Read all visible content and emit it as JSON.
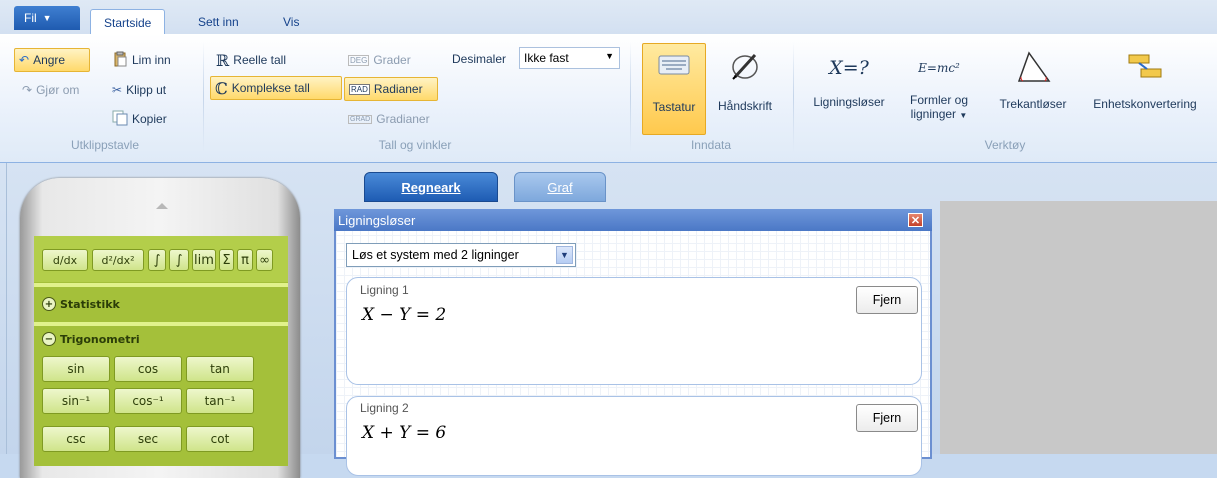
{
  "menu": {
    "file_label": "Fil",
    "file_arrow": "▼"
  },
  "tabs": [
    "Startside",
    "Sett inn",
    "Vis"
  ],
  "ribbon": {
    "clipboard": {
      "undo": "Angre",
      "redo": "Gjør om",
      "paste": "Lim inn",
      "cut": "Klipp ut",
      "copy": "Kopier",
      "group": "Utklippstavle"
    },
    "numbers": {
      "real": "Reelle tall",
      "complex": "Komplekse tall",
      "degrees_badge": "DEG",
      "degrees": "Grader",
      "radians_badge": "RAD",
      "radians": "Radianer",
      "gradians_badge": "GRAD",
      "gradians": "Gradianer",
      "decimals_label": "Desimaler",
      "decimals_value": "Ikke fast",
      "group": "Tall og vinkler"
    },
    "input": {
      "keyboard": "Tastatur",
      "handwriting": "Håndskrift",
      "group": "Inndata"
    },
    "tools": {
      "equation_solver_icon": "X=?",
      "equation_solver": "Ligningsløser",
      "formulas_icon": "E=mc²",
      "formulas_line1": "Formler og",
      "formulas_line2": "ligninger",
      "triangle_solver": "Trekantløser",
      "unit_converter": "Enhetskonvertering",
      "group": "Verktøy"
    }
  },
  "calculator": {
    "calculus_buttons": [
      "d/dx",
      "d²/dx²",
      "∫",
      "∫",
      "lim",
      "Σ",
      "π",
      "∞"
    ],
    "sections": {
      "statistics": "Statistikk",
      "trigonometry": "Trigonometri"
    },
    "trig_rows": [
      [
        "sin",
        "cos",
        "tan"
      ],
      [
        "sin⁻¹",
        "cos⁻¹",
        "tan⁻¹"
      ],
      [
        "csc",
        "sec",
        "cot"
      ]
    ]
  },
  "doc_tabs": {
    "spreadsheet": "Regneark",
    "graph": "Graf"
  },
  "dialog": {
    "title": "Ligningsløser",
    "system_select": "Løs et system med 2 ligninger",
    "equations": [
      {
        "label": "Ligning 1",
        "math": "X − Y = 2",
        "remove": "Fjern"
      },
      {
        "label": "Ligning 2",
        "math": "X + Y = 6",
        "remove": "Fjern"
      }
    ]
  },
  "colors": {
    "accent": "#1e5cb3",
    "highlight": "#ffd96b",
    "calc_green": "#a4c03a"
  }
}
